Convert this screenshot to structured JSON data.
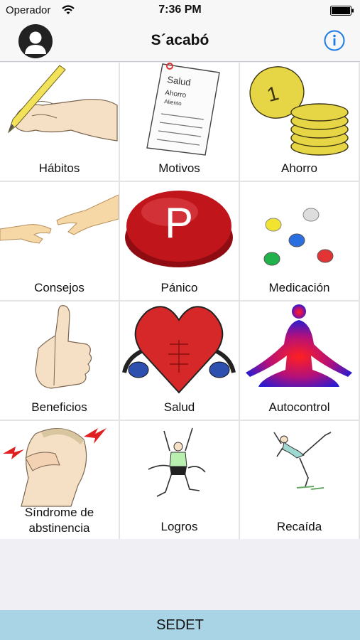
{
  "status_bar": {
    "carrier": "Operador",
    "time": "7:36 PM"
  },
  "nav": {
    "title": "S´acabó"
  },
  "grid": [
    {
      "label": "Hábitos",
      "icon": "hand-writing-icon"
    },
    {
      "label": "Motivos",
      "icon": "checklist-paper-icon"
    },
    {
      "label": "Ahorro",
      "icon": "coins-icon"
    },
    {
      "label": "Consejos",
      "icon": "reaching-hands-icon"
    },
    {
      "label": "Pánico",
      "icon": "panic-button-icon"
    },
    {
      "label": "Medicación",
      "icon": "pills-icon"
    },
    {
      "label": "Beneficios",
      "icon": "thumbs-up-icon"
    },
    {
      "label": "Salud",
      "icon": "boxing-heart-icon"
    },
    {
      "label": "Autocontrol",
      "icon": "meditation-icon"
    },
    {
      "label": "Síndrome de abstinencia",
      "label_line1": "Síndrome de",
      "label_line2": "abstinencia",
      "icon": "headache-icon"
    },
    {
      "label": "Logros",
      "icon": "celebrating-runner-icon"
    },
    {
      "label": "Recaída",
      "icon": "falling-person-icon"
    }
  ],
  "footer": {
    "label": "SEDET"
  },
  "colors": {
    "footer_bg": "#a8d4e6",
    "info_blue": "#1a7ae6",
    "panic_red": "#c0151b"
  }
}
